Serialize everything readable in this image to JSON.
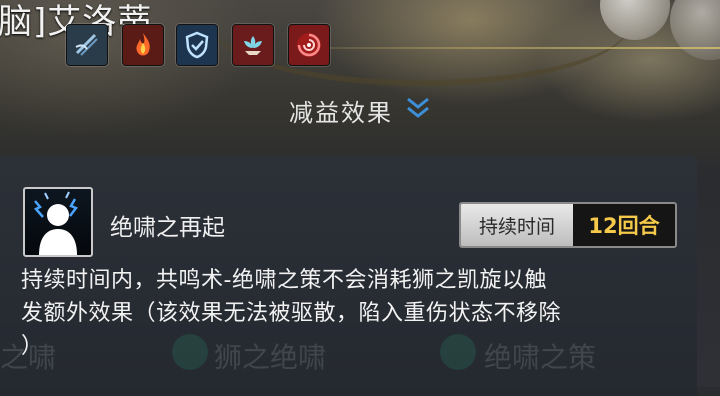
{
  "character": {
    "name": "脑]艾洛蒂"
  },
  "effect_icons": [
    {
      "name": "wind-slash-icon",
      "color": "#2a3b4a"
    },
    {
      "name": "flame-icon",
      "color": "#5a1a16"
    },
    {
      "name": "shield-check-icon",
      "color": "#1e3550"
    },
    {
      "name": "lotus-icon",
      "color": "#6a1c1c"
    },
    {
      "name": "red-swirl-icon",
      "color": "#7a1a1a"
    }
  ],
  "debuff_section": {
    "title": "减益效果",
    "chevron_color": "#3d8fd9"
  },
  "effect": {
    "name": "绝啸之再起",
    "duration_label": "持续时间",
    "duration_value": "12回合",
    "description_line1": "持续时间内，共鸣术-绝啸之策不会消耗狮之凯旋以触",
    "description_line2": "发额外效果（该效果无法被驱散，陷入重伤状态不移除",
    "description_line3": "）"
  },
  "background_text": {
    "left": "之啸",
    "middle": "狮之绝啸",
    "right": "绝啸之策"
  }
}
